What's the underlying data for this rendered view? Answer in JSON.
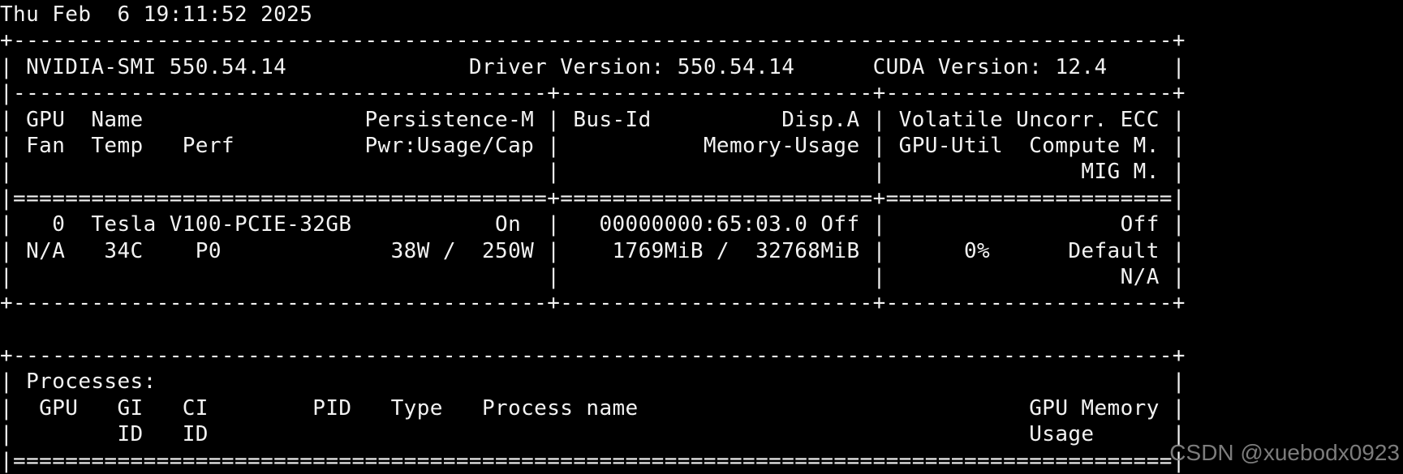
{
  "terminal": {
    "timestamp": "Thu Feb  6 19:11:52 2025",
    "lines": [
      "Thu Feb  6 19:11:52 2025",
      "+-----------------------------------------------------------------------------------------+",
      "| NVIDIA-SMI 550.54.14              Driver Version: 550.54.14      CUDA Version: 12.4     |",
      "|-----------------------------------------+------------------------+----------------------+",
      "| GPU  Name                 Persistence-M | Bus-Id          Disp.A | Volatile Uncorr. ECC |",
      "| Fan  Temp   Perf          Pwr:Usage/Cap |           Memory-Usage | GPU-Util  Compute M. |",
      "|                                         |                        |               MIG M. |",
      "|=========================================+========================+======================|",
      "|   0  Tesla V100-PCIE-32GB           On  |   00000000:65:03.0 Off |                  Off |",
      "| N/A   34C    P0             38W /  250W |    1769MiB /  32768MiB |      0%      Default |",
      "|                                         |                        |                  N/A |",
      "+-----------------------------------------+------------------------+----------------------+",
      "",
      "+-----------------------------------------------------------------------------------------+",
      "| Processes:                                                                              |",
      "|  GPU   GI   CI        PID   Type   Process name                              GPU Memory |",
      "|        ID   ID                                                               Usage      |",
      "|=========================================================================================|"
    ]
  },
  "watermark": "CSDN @xuebodx0923"
}
